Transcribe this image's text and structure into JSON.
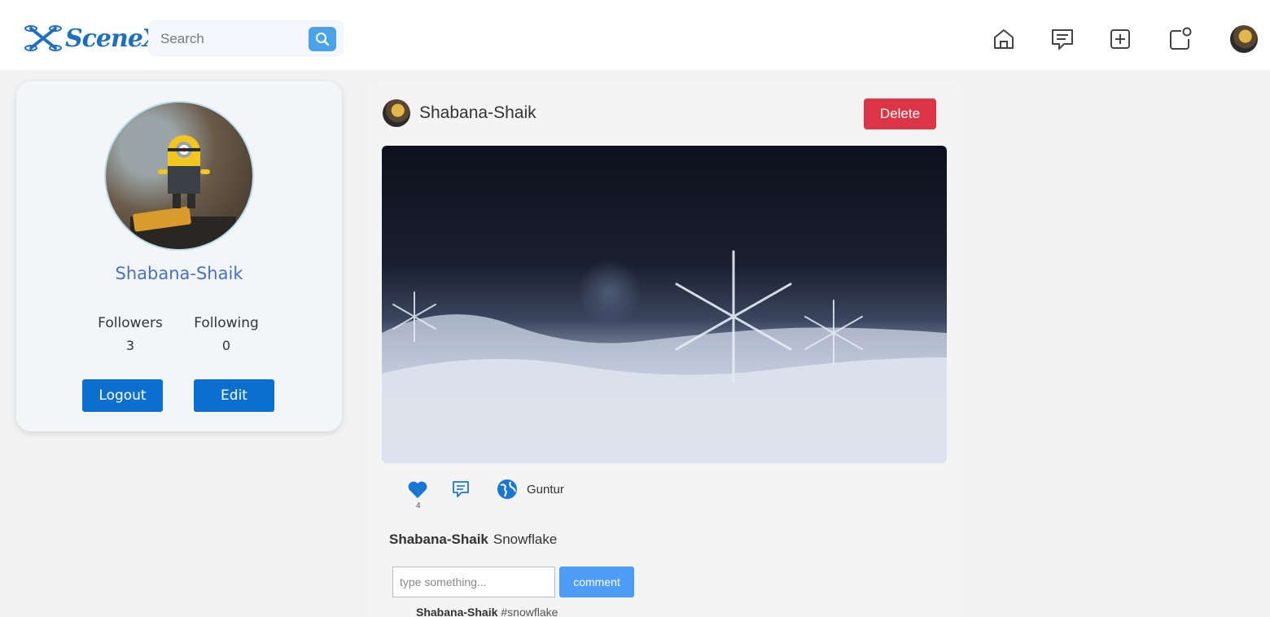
{
  "header": {
    "logo_text": "SceneX",
    "search_placeholder": "Search"
  },
  "nav": {
    "icons": [
      "home-icon",
      "messages-icon",
      "create-post-icon",
      "notifications-icon",
      "profile-avatar"
    ]
  },
  "profile": {
    "username": "Shabana-Shaik",
    "followers_label": "Followers",
    "followers_count": "3",
    "following_label": "Following",
    "following_count": "0",
    "logout_label": "Logout",
    "edit_label": "Edit"
  },
  "post": {
    "username": "Shabana-Shaik",
    "delete_label": "Delete",
    "like_count": "4",
    "location": "Guntur",
    "caption_user": "Shabana-Shaik",
    "caption_text": "Snowflake",
    "comment_placeholder": "type something...",
    "comment_button": "comment",
    "comments": [
      {
        "user": "Shabana-Shaik",
        "text": "#snowflake"
      }
    ]
  },
  "colors": {
    "primary": "#0b6fd0",
    "delete": "#dc3545",
    "comment_button": "#4d9df7",
    "profile_name": "#4a6fc4",
    "search_button": "#4aa3e8"
  }
}
